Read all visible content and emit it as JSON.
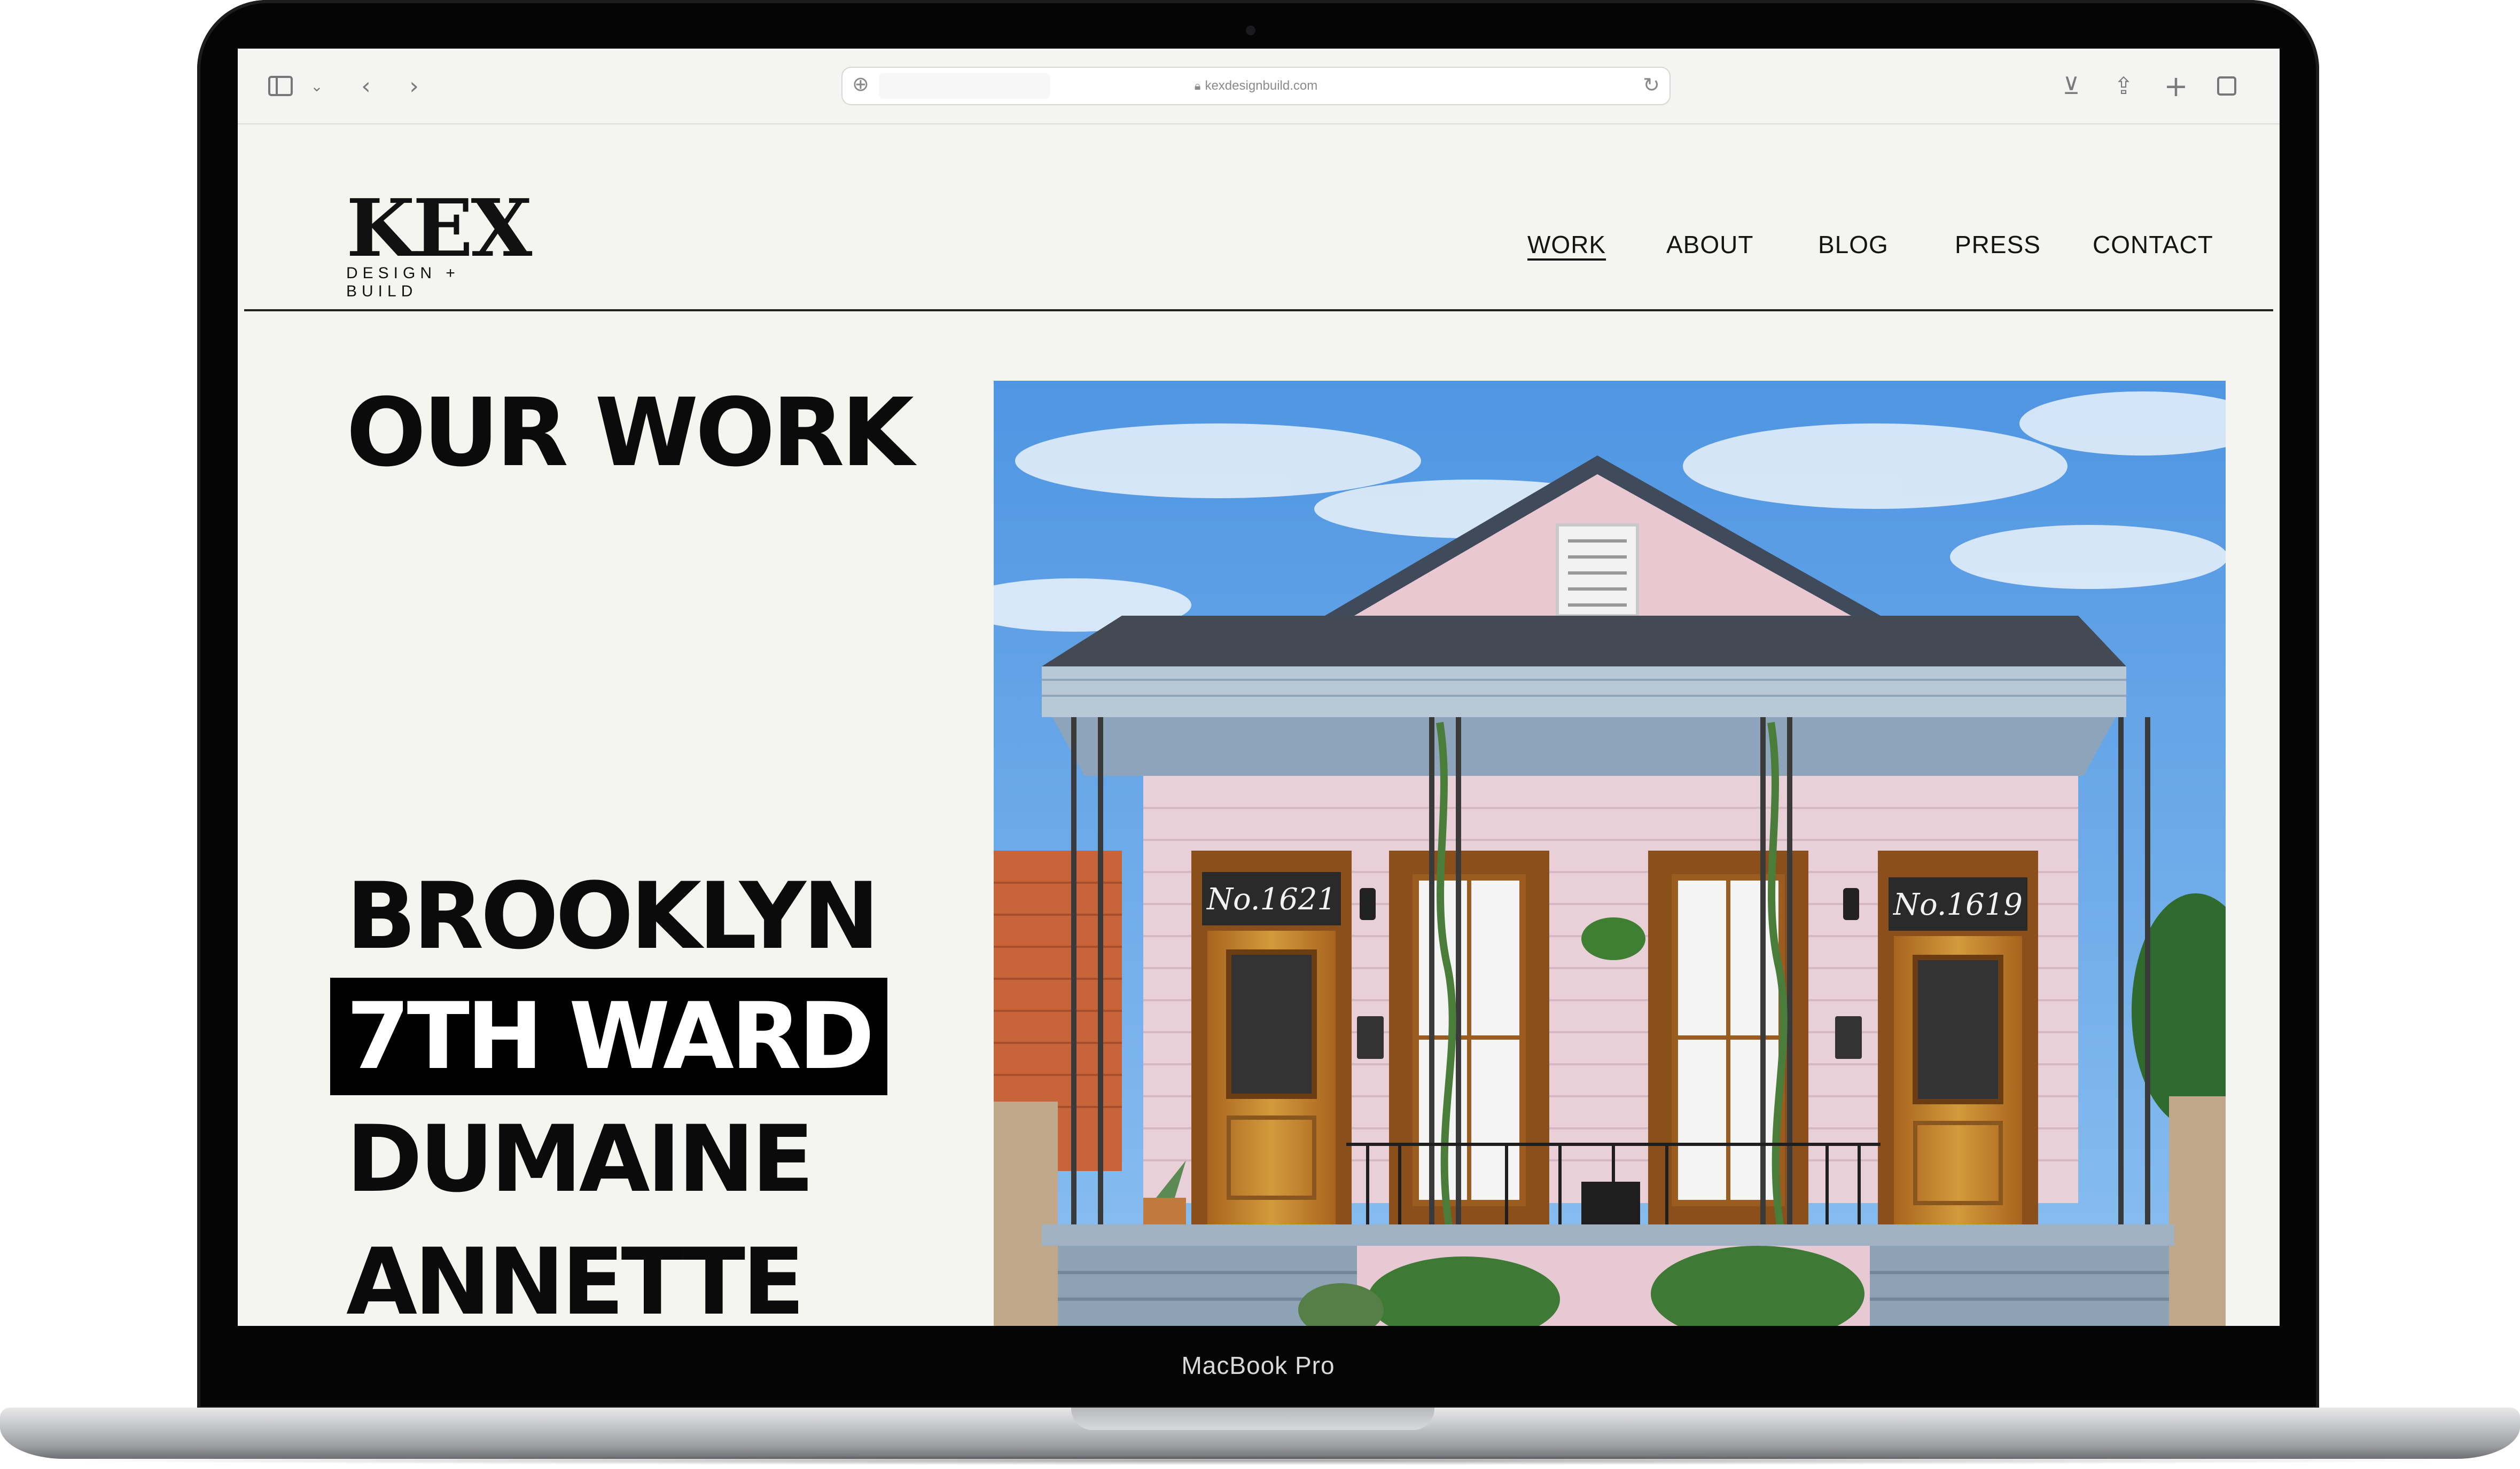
{
  "device": {
    "label": "MacBook Pro"
  },
  "browser": {
    "url": "kexdesignbuild.com"
  },
  "site": {
    "logo_mark": "KEX",
    "logo_sub": "DESIGN + BUILD",
    "nav": [
      {
        "label": "WORK",
        "active": true
      },
      {
        "label": "ABOUT",
        "active": false
      },
      {
        "label": "BLOG",
        "active": false
      },
      {
        "label": "PRESS",
        "active": false
      },
      {
        "label": "CONTACT",
        "active": false
      }
    ]
  },
  "main": {
    "title": "OUR WORK",
    "projects": [
      {
        "label": "BROOKLYN",
        "selected": false
      },
      {
        "label": "7TH WARD",
        "selected": true
      },
      {
        "label": "DUMAINE",
        "selected": false
      },
      {
        "label": "ANNETTE",
        "selected": false
      }
    ],
    "hero": {
      "left_door_number": "No.1621",
      "right_door_number": "No.1619"
    }
  },
  "colors": {
    "page_bg": "#f4f4f0",
    "text": "#0b0b0b",
    "house_pink": "#e8cfd8",
    "sky": "#5aa0e6"
  }
}
